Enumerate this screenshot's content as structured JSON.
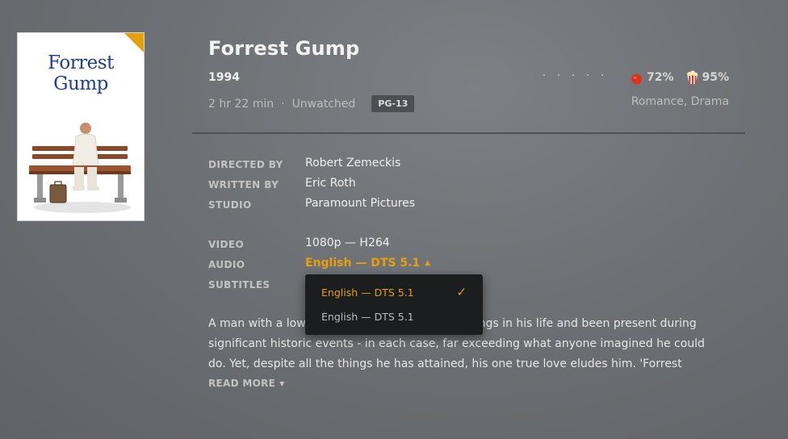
{
  "movie": {
    "title": "Forrest Gump",
    "year": "1994",
    "duration": "2 hr 22 min",
    "separator": "·",
    "watch_status": "Unwatched",
    "content_rating": "PG-13",
    "genres": "Romance, Drama",
    "user_rating_stars": 0,
    "critic_score": "72%",
    "audience_score": "95%"
  },
  "poster": {
    "title_line1": "Forrest",
    "title_line2": "Gump",
    "corner_color": "#e5a00d"
  },
  "details": {
    "directed_by_label": "DIRECTED BY",
    "directed_by": "Robert Zemeckis",
    "written_by_label": "WRITTEN BY",
    "written_by": "Eric Roth",
    "studio_label": "STUDIO",
    "studio": "Paramount Pictures",
    "video_label": "VIDEO",
    "video": "1080p — H264",
    "audio_label": "AUDIO",
    "audio": "English — DTS 5.1",
    "subtitles_label": "SUBTITLES"
  },
  "audio_dropdown": {
    "options": [
      {
        "label": "English — DTS 5.1",
        "selected": true
      },
      {
        "label": "English — DTS 5.1",
        "selected": false
      }
    ],
    "check_icon": "✓"
  },
  "summary": {
    "text": "A man with a low IQ has accomplished great things in his life and been present during significant historic events - in each case, far exceeding what anyone imagined he could do. Yet, despite all the things he has attained, his one true love eludes him. 'Forrest",
    "read_more": "READ MORE"
  },
  "colors": {
    "accent": "#e5a00d",
    "background": "#6d7074",
    "dropdown_bg": "#1c1d1f"
  },
  "icons": {
    "critic": "tomato-icon",
    "audience": "popcorn-icon",
    "caret_up": "caret-up-icon",
    "caret_down": "caret-down-icon"
  }
}
